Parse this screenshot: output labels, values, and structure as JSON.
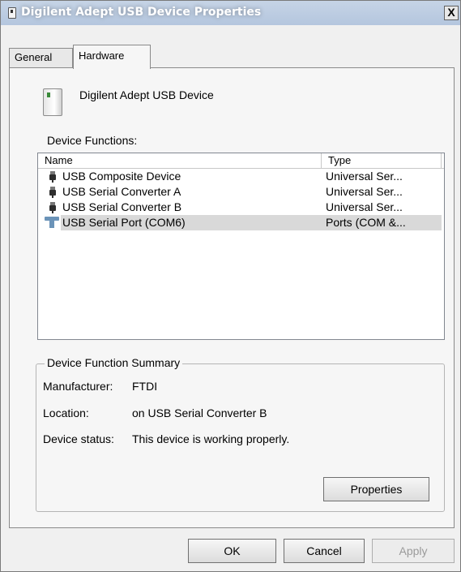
{
  "window": {
    "title": "Digilent Adept USB Device Properties",
    "close_label": "X"
  },
  "tabs": [
    {
      "label": "General"
    },
    {
      "label": "Hardware"
    }
  ],
  "device": {
    "name": "Digilent Adept USB Device"
  },
  "functions": {
    "label": "Device Functions:",
    "columns": {
      "name": "Name",
      "type": "Type"
    },
    "rows": [
      {
        "name": "USB Composite Device",
        "type": "Universal Ser...",
        "icon": "usb-plug-icon"
      },
      {
        "name": "USB Serial Converter A",
        "type": "Universal Ser...",
        "icon": "usb-plug-icon"
      },
      {
        "name": "USB Serial Converter B",
        "type": "Universal Ser...",
        "icon": "usb-plug-icon"
      },
      {
        "name": "USB Serial Port (COM6)",
        "type": "Ports (COM &...",
        "icon": "serial-port-icon",
        "selected": true
      }
    ]
  },
  "summary": {
    "title": "Device Function Summary",
    "manufacturer_label": "Manufacturer:",
    "manufacturer_value": "FTDI",
    "location_label": "Location:",
    "location_value": "on USB Serial Converter B",
    "status_label": "Device status:",
    "status_value": "This device is working properly.",
    "properties_button": "Properties"
  },
  "buttons": {
    "ok": "OK",
    "cancel": "Cancel",
    "apply": "Apply"
  },
  "colors": {
    "selection": "#d9d9d9",
    "titlebar": "#b4c6de",
    "port_icon": "#6b93b8"
  }
}
